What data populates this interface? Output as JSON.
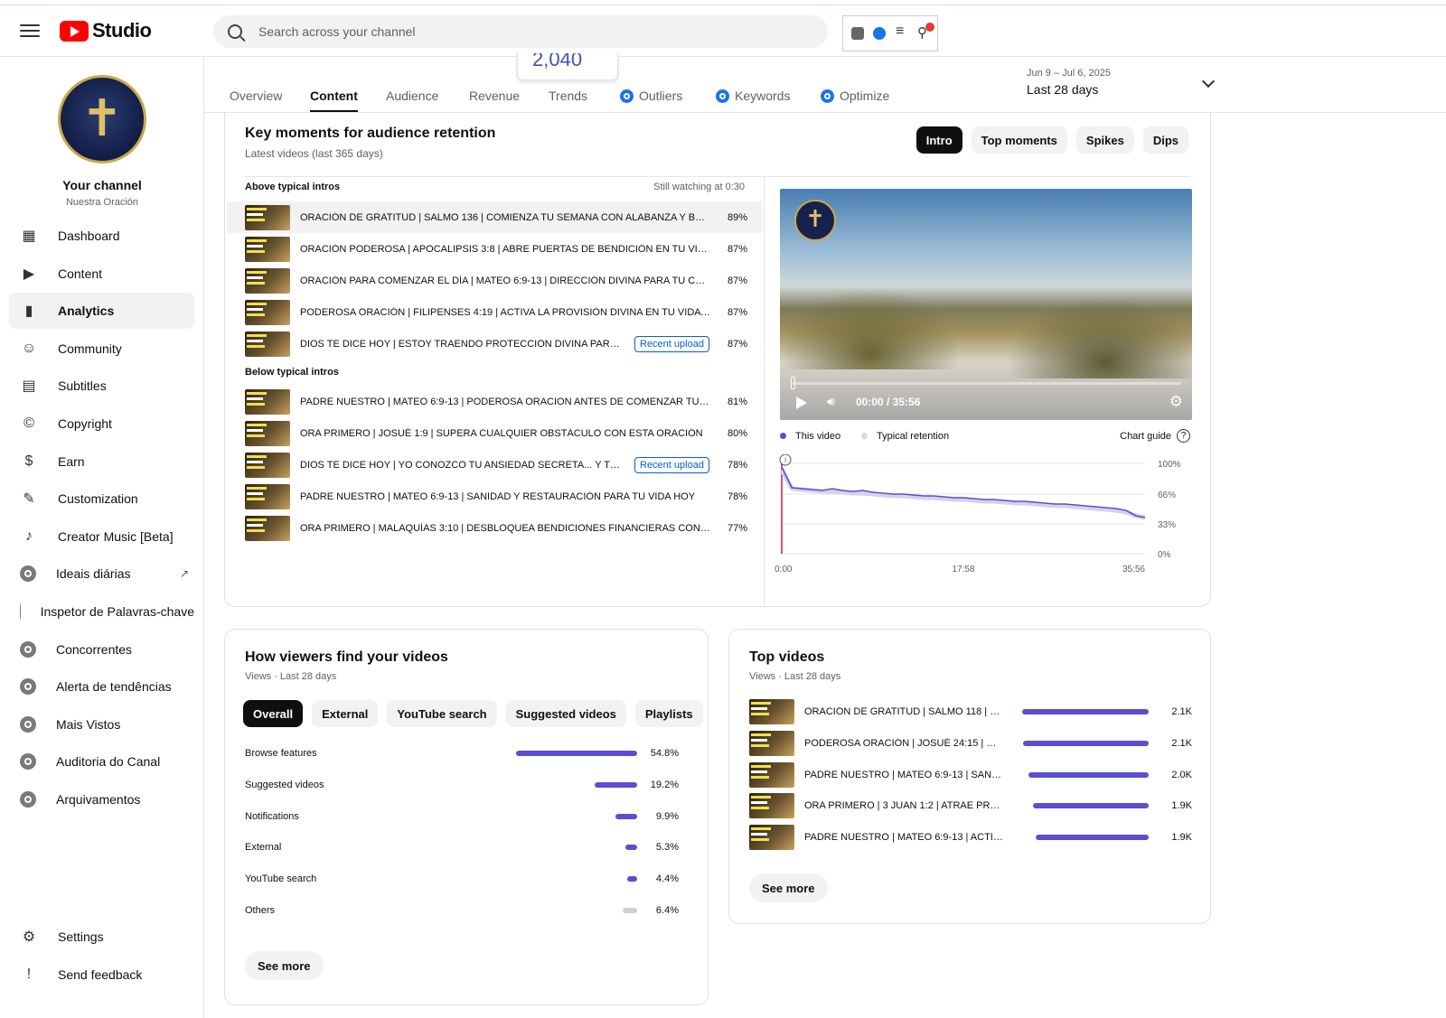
{
  "app": {
    "logo_text": "Studio",
    "search_placeholder": "Search across your channel"
  },
  "channel": {
    "name": "Your channel",
    "handle": "Nuestra Oración"
  },
  "sidebar": {
    "items": [
      {
        "label": "Dashboard",
        "icon": "dashboard-icon"
      },
      {
        "label": "Content",
        "icon": "content-icon"
      },
      {
        "label": "Analytics",
        "icon": "analytics-icon",
        "active": true
      },
      {
        "label": "Community",
        "icon": "community-icon"
      },
      {
        "label": "Subtitles",
        "icon": "subtitles-icon"
      },
      {
        "label": "Copyright",
        "icon": "copyright-icon"
      },
      {
        "label": "Earn",
        "icon": "earn-icon"
      },
      {
        "label": "Customization",
        "icon": "customization-icon"
      },
      {
        "label": "Creator Music [Beta]",
        "icon": "music-icon"
      },
      {
        "label": "Ideais diárias",
        "icon": "extension-icon"
      },
      {
        "label": "Inspetor de Palavras-chave",
        "icon": "extension-icon"
      },
      {
        "label": "Concorrentes",
        "icon": "extension-icon"
      },
      {
        "label": "Alerta de tendências",
        "icon": "extension-icon"
      },
      {
        "label": "Mais Vistos",
        "icon": "extension-icon"
      },
      {
        "label": "Auditoria do Canal",
        "icon": "extension-icon"
      },
      {
        "label": "Arquivamentos",
        "icon": "extension-icon"
      }
    ],
    "bottom": [
      {
        "label": "Settings",
        "icon": "settings-icon"
      },
      {
        "label": "Send feedback",
        "icon": "feedback-icon"
      }
    ]
  },
  "tabs": {
    "items": [
      "Overview",
      "Content",
      "Audience",
      "Revenue",
      "Trends",
      "Outliers",
      "Keywords",
      "Optimize"
    ],
    "active": "Content",
    "popup_value": "2,040"
  },
  "daterange": {
    "range": "Jun 9 – Jul 6, 2025",
    "label": "Last 28 days"
  },
  "key_moments": {
    "title": "Key moments for audience retention",
    "subtitle": "Latest videos (last 365 days)",
    "chips": [
      "Intro",
      "Top moments",
      "Spikes",
      "Dips"
    ],
    "above_heading": "Above typical intros",
    "still_watching": "Still watching at 0:30",
    "below_heading": "Below typical intros",
    "recent_badge": "Recent upload",
    "above": [
      {
        "title": "ORACIÓN DE GRATITUD | SALMO 136 | COMIENZA TU SEMANA CON ALABANZA Y BEN...",
        "pct": "89%"
      },
      {
        "title": "ORACIÓN PODEROSA | APOCALIPSIS 3:8 | ABRE PUERTAS DE BENDICIÓN EN TU VIDA H...",
        "pct": "87%"
      },
      {
        "title": "ORACIÓN PARA COMENZAR EL DÍA | MATEO 6:9-13 | DIRECCIÓN DIVINA PARA TU CAMI...",
        "pct": "87%"
      },
      {
        "title": "PODEROSA ORACIÓN | FILIPENSES 4:19 | ACTIVA LA PROVISIÓN DIVINA EN TU VIDA H...",
        "pct": "87%"
      },
      {
        "title": "DIOS TE DICE HOY | ESTOY TRAENDO PROTECCIÓN DIVINA PARA TU ...",
        "pct": "87%"
      }
    ],
    "below": [
      {
        "title": "PADRE NUESTRO | MATEO 6:9-13 | PODEROSA ORACION ANTES DE COMENZAR TU DÍA",
        "pct": "81%"
      },
      {
        "title": "ORA PRIMERO | JOSUÉ 1:9 | SUPERA CUALQUIER OBSTÁCULO CON ESTA ORACIÓN",
        "pct": "80%"
      },
      {
        "title": "DIOS TE DICE HOY | YO CONOZCO TU ANSIEDAD SECRETA... Y TRAIG...",
        "pct": "78%"
      },
      {
        "title": "PADRE NUESTRO | MATEO 6:9-13 | SANIDAD Y RESTAURACIÓN PARA TU VIDA HOY",
        "pct": "78%"
      },
      {
        "title": "ORA PRIMERO | MALAQUÍAS 3:10 | DESBLOQUEA BENDICIONES FINANCIERAS CON ES...",
        "pct": "77%"
      }
    ],
    "player_time": "00:00 / 35:56",
    "legend_this": "This video",
    "legend_typical": "Typical retention",
    "chart_guide": "Chart guide"
  },
  "chart_data": {
    "type": "line",
    "title": "",
    "xlabel": "",
    "ylabel": "",
    "x_ticks": [
      "0:00",
      "17:58",
      "35:56"
    ],
    "y_ticks": [
      "100%",
      "66%",
      "33%",
      "0%"
    ],
    "ylim": [
      0,
      100
    ],
    "x": [
      0,
      1,
      2,
      3,
      4,
      5,
      6,
      7,
      8,
      9,
      10,
      11,
      12,
      13,
      14,
      15,
      16,
      17,
      18,
      19,
      20,
      21,
      22,
      23,
      24,
      25,
      26,
      27,
      28,
      29,
      30,
      31,
      32,
      33,
      34,
      35,
      35.9
    ],
    "series": [
      {
        "name": "This video",
        "color": "#5a4fcf",
        "values": [
          96,
          73,
          72,
          71,
          70,
          72,
          70,
          69,
          70,
          68,
          67,
          66,
          66,
          65,
          64,
          64,
          63,
          62,
          62,
          61,
          60,
          60,
          59,
          58,
          58,
          57,
          56,
          55,
          55,
          54,
          53,
          52,
          51,
          50,
          48,
          42,
          40
        ]
      },
      {
        "name": "Typical retention",
        "color": "#d6d1ee",
        "values": [
          93,
          72,
          71,
          70,
          69,
          69,
          68,
          67,
          67,
          66,
          65,
          64,
          64,
          63,
          62,
          62,
          61,
          60,
          60,
          59,
          58,
          58,
          57,
          56,
          56,
          55,
          54,
          53,
          53,
          52,
          51,
          50,
          49,
          48,
          46,
          42,
          40
        ]
      }
    ]
  },
  "traffic": {
    "title": "How viewers find your videos",
    "subtitle": "Views · Last 28 days",
    "chips": [
      "Overall",
      "External",
      "YouTube search",
      "Suggested videos",
      "Playlists"
    ],
    "rows": [
      {
        "label": "Browse features",
        "value": "54.8%",
        "share": 54.8
      },
      {
        "label": "Suggested videos",
        "value": "19.2%",
        "share": 19.2
      },
      {
        "label": "Notifications",
        "value": "9.9%",
        "share": 9.9
      },
      {
        "label": "External",
        "value": "5.3%",
        "share": 5.3
      },
      {
        "label": "YouTube search",
        "value": "4.4%",
        "share": 4.4
      },
      {
        "label": "Others",
        "value": "6.4%",
        "share": 6.4,
        "grey": true
      }
    ],
    "see_more": "See more"
  },
  "top_videos": {
    "title": "Top videos",
    "subtitle": "Views · Last 28 days",
    "rows": [
      {
        "title": "ORACIÓN DE GRATITUD | SALMO 118 | C...",
        "value": "2.1K",
        "views": 2100
      },
      {
        "title": "PODEROSA ORACIÓN | JOSUÉ 24:15 | RE...",
        "value": "2.1K",
        "views": 2080
      },
      {
        "title": "PADRE NUESTRO | MATEO 6:9-13 | SANID...",
        "value": "2.0K",
        "views": 2000
      },
      {
        "title": "ORA PRIMERO | 3 JUAN 1:2 | ATRAE PRO...",
        "value": "1.9K",
        "views": 1920
      },
      {
        "title": "PADRE NUESTRO | MATEO 6:9-13 | ACTIV...",
        "value": "1.9K",
        "views": 1880
      }
    ],
    "see_more": "See more"
  }
}
